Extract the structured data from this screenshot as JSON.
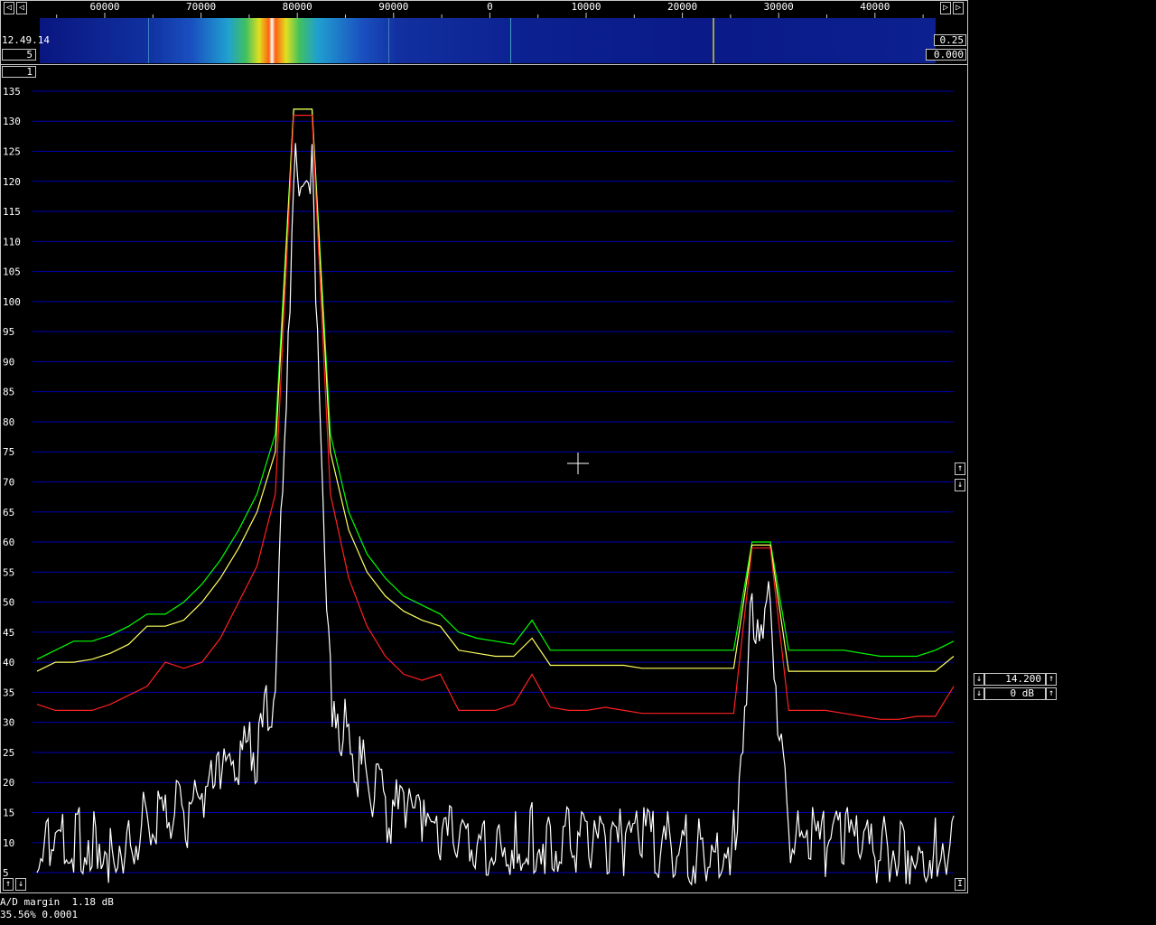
{
  "app": {
    "timestamp": "12.49.14",
    "waterfall_avg": "5",
    "channel_field": "1",
    "right_top_value": "0.25",
    "right_bottom_value": "0.000",
    "gain_value": "14.200",
    "db_value": "0 dB",
    "status_line1": "A/D margin  1.18 dB",
    "status_line2": "35.56% 0.0001",
    "bottom_right_btn": "I"
  },
  "icons": {
    "left": "arrow-left-icon",
    "right": "arrow-right-icon",
    "up": "arrow-up-icon",
    "down": "arrow-down-icon",
    "crosshair": "crosshair-icon"
  },
  "colors": {
    "grid": "#0000b4",
    "max_hold": "#00ff00",
    "average": "#ffff60",
    "min": "#ff2020",
    "live": "#ffffff"
  },
  "chart_data": {
    "type": "line",
    "x_tick_labels": [
      "60000",
      "70000",
      "80000",
      "90000",
      "0",
      "10000",
      "20000",
      "30000",
      "40000"
    ],
    "y_ticks": [
      5,
      10,
      15,
      20,
      25,
      30,
      35,
      40,
      45,
      50,
      55,
      60,
      65,
      70,
      75,
      80,
      85,
      90,
      95,
      100,
      105,
      110,
      115,
      120,
      125,
      130,
      135
    ],
    "ylim": [
      2,
      138
    ],
    "x_points": [
      0,
      2,
      4,
      6,
      8,
      10,
      12,
      14,
      16,
      18,
      20,
      22,
      24,
      26,
      28,
      30,
      32,
      34,
      36,
      38,
      40,
      42,
      44,
      46,
      48,
      50,
      52,
      54,
      56,
      58,
      60,
      62,
      64,
      66,
      68,
      70,
      72,
      74,
      76,
      78,
      80,
      82,
      84,
      86,
      88,
      90,
      92,
      94,
      96,
      98,
      100
    ],
    "series": [
      {
        "values": [
          40.5,
          42,
          43.5,
          43.5,
          44.5,
          46,
          48,
          48,
          50,
          53,
          57,
          62,
          68,
          78,
          132,
          132,
          78,
          65,
          58,
          54,
          51,
          49.5,
          48,
          45,
          44,
          43.5,
          43,
          47,
          42,
          42,
          42,
          42,
          42,
          42,
          42,
          42,
          42,
          42,
          42,
          60,
          60,
          42,
          42,
          42,
          42,
          41.5,
          41,
          41,
          41,
          42,
          43.5
        ]
      },
      {
        "values": [
          38.5,
          40,
          40,
          40.5,
          41.5,
          43,
          46,
          46,
          47,
          50,
          54,
          59,
          65,
          75,
          132,
          132,
          75,
          62,
          55,
          51,
          48.5,
          47,
          46,
          42,
          41.5,
          41,
          41,
          44,
          39.5,
          39.5,
          39.5,
          39.5,
          39.5,
          39,
          39,
          39,
          39,
          39,
          39,
          59.5,
          59.5,
          38.5,
          38.5,
          38.5,
          38.5,
          38.5,
          38.5,
          38.5,
          38.5,
          38.5,
          41
        ]
      },
      {
        "values": [
          33,
          32,
          32,
          32,
          33,
          34.5,
          36,
          40,
          39,
          40,
          44,
          50,
          56,
          68,
          131,
          131,
          68,
          54,
          46,
          41,
          38,
          37,
          38,
          32,
          32,
          32,
          33,
          38,
          32.5,
          32,
          32,
          32.5,
          32,
          31.5,
          31.5,
          31.5,
          31.5,
          31.5,
          31.5,
          59,
          59,
          32,
          32,
          32,
          31.5,
          31,
          30.5,
          30.5,
          31,
          31,
          36
        ]
      },
      {
        "values": [
          5,
          14,
          12,
          13,
          11,
          13,
          15,
          17,
          16,
          18,
          22,
          25,
          28,
          38,
          123,
          123,
          38,
          28,
          22,
          18,
          16,
          14,
          13,
          13,
          12,
          12,
          12,
          13,
          12,
          12,
          12,
          12,
          12,
          12,
          12,
          11,
          11,
          12,
          12,
          50,
          50,
          12,
          12,
          12,
          12,
          12,
          11,
          11,
          11,
          12,
          12
        ]
      }
    ]
  }
}
